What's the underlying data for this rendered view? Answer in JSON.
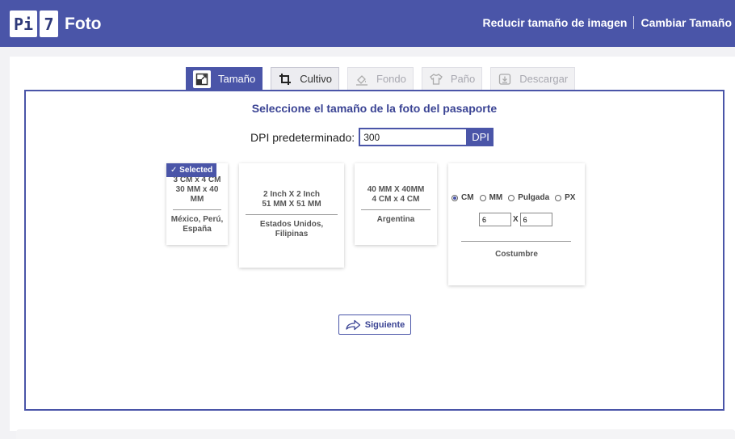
{
  "header": {
    "logo": {
      "part1": "Pi",
      "part2": "7",
      "name": "Foto"
    },
    "nav": [
      {
        "label": "Reducir tamaño de imagen"
      },
      {
        "label": "Cambiar Tamaño"
      }
    ],
    "background_color": "#4a55a8"
  },
  "tabs": [
    {
      "label": "Tamaño",
      "icon": "resize-icon",
      "state": "active"
    },
    {
      "label": "Cultivo",
      "icon": "crop-icon",
      "state": "normal"
    },
    {
      "label": "Fondo",
      "icon": "fill-icon",
      "state": "disabled"
    },
    {
      "label": "Paño",
      "icon": "shirt-icon",
      "state": "disabled"
    },
    {
      "label": "Descargar",
      "icon": "download-icon",
      "state": "disabled"
    }
  ],
  "main": {
    "title": "Seleccione el tamaño de la foto del pasaporte",
    "dpi": {
      "label": "DPI predeterminado:",
      "value": "300",
      "unit": "DPI"
    },
    "cards": [
      {
        "badge": "✓ Selected",
        "sizes": [
          "3 CM x 4 CM",
          "30 MM x 40",
          "MM"
        ],
        "countries": [
          "México, Perú,",
          "España"
        ]
      },
      {
        "sizes": [
          "2 Inch X 2 Inch",
          "51 MM X 51 MM"
        ],
        "countries": [
          "Estados Unidos,",
          "Filipinas"
        ]
      },
      {
        "sizes": [
          "40 MM X 40MM",
          "4 CM x 4 CM"
        ],
        "countries": [
          "Argentina"
        ]
      }
    ],
    "custom": {
      "units": [
        {
          "label": "CM",
          "checked": true
        },
        {
          "label": "MM",
          "checked": false
        },
        {
          "label": "Pulgada",
          "checked": false
        },
        {
          "label": "PX",
          "checked": false
        }
      ],
      "width": "6",
      "separator": "X",
      "height": "6",
      "label": "Costumbre"
    },
    "next_label": "Siguiente"
  },
  "colors": {
    "accent": "#4a55a8",
    "title_text": "#3b4494"
  }
}
